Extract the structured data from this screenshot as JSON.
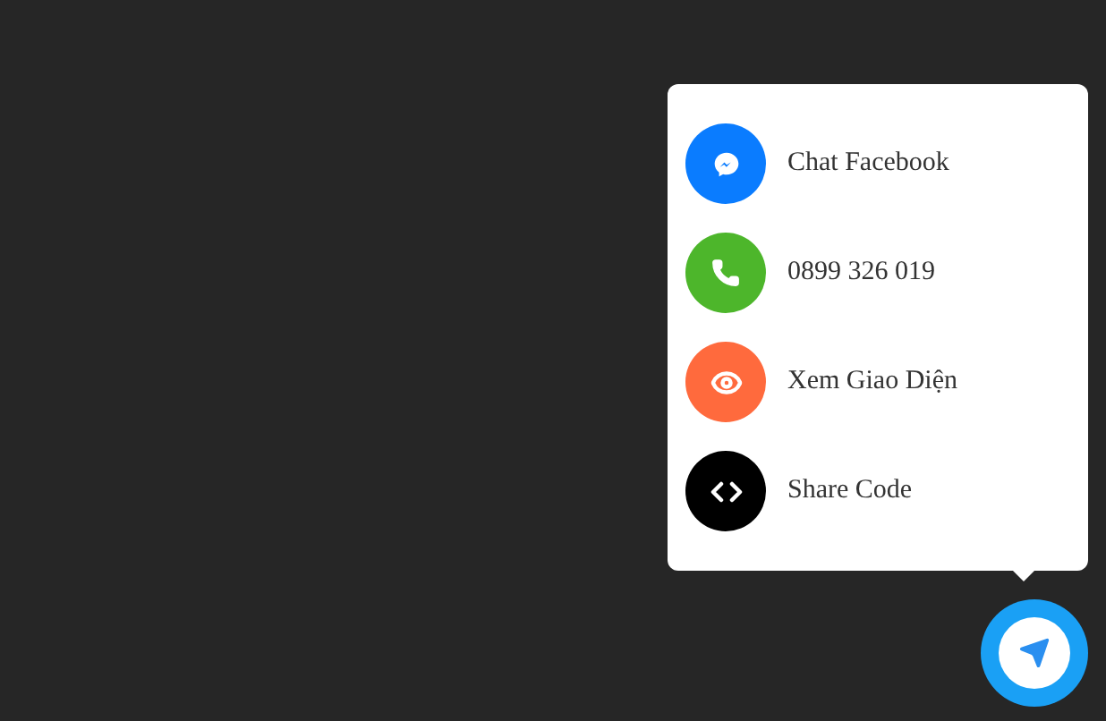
{
  "contact_menu": {
    "items": [
      {
        "kind": "messenger",
        "label": "Chat Facebook",
        "color": "#0a7cff"
      },
      {
        "kind": "phone",
        "label": "0899 326 019",
        "color": "#4db62b"
      },
      {
        "kind": "eye",
        "label": "Xem Giao Diện",
        "color": "#ff6a3d"
      },
      {
        "kind": "code",
        "label": "Share Code",
        "color": "#000000"
      }
    ]
  }
}
